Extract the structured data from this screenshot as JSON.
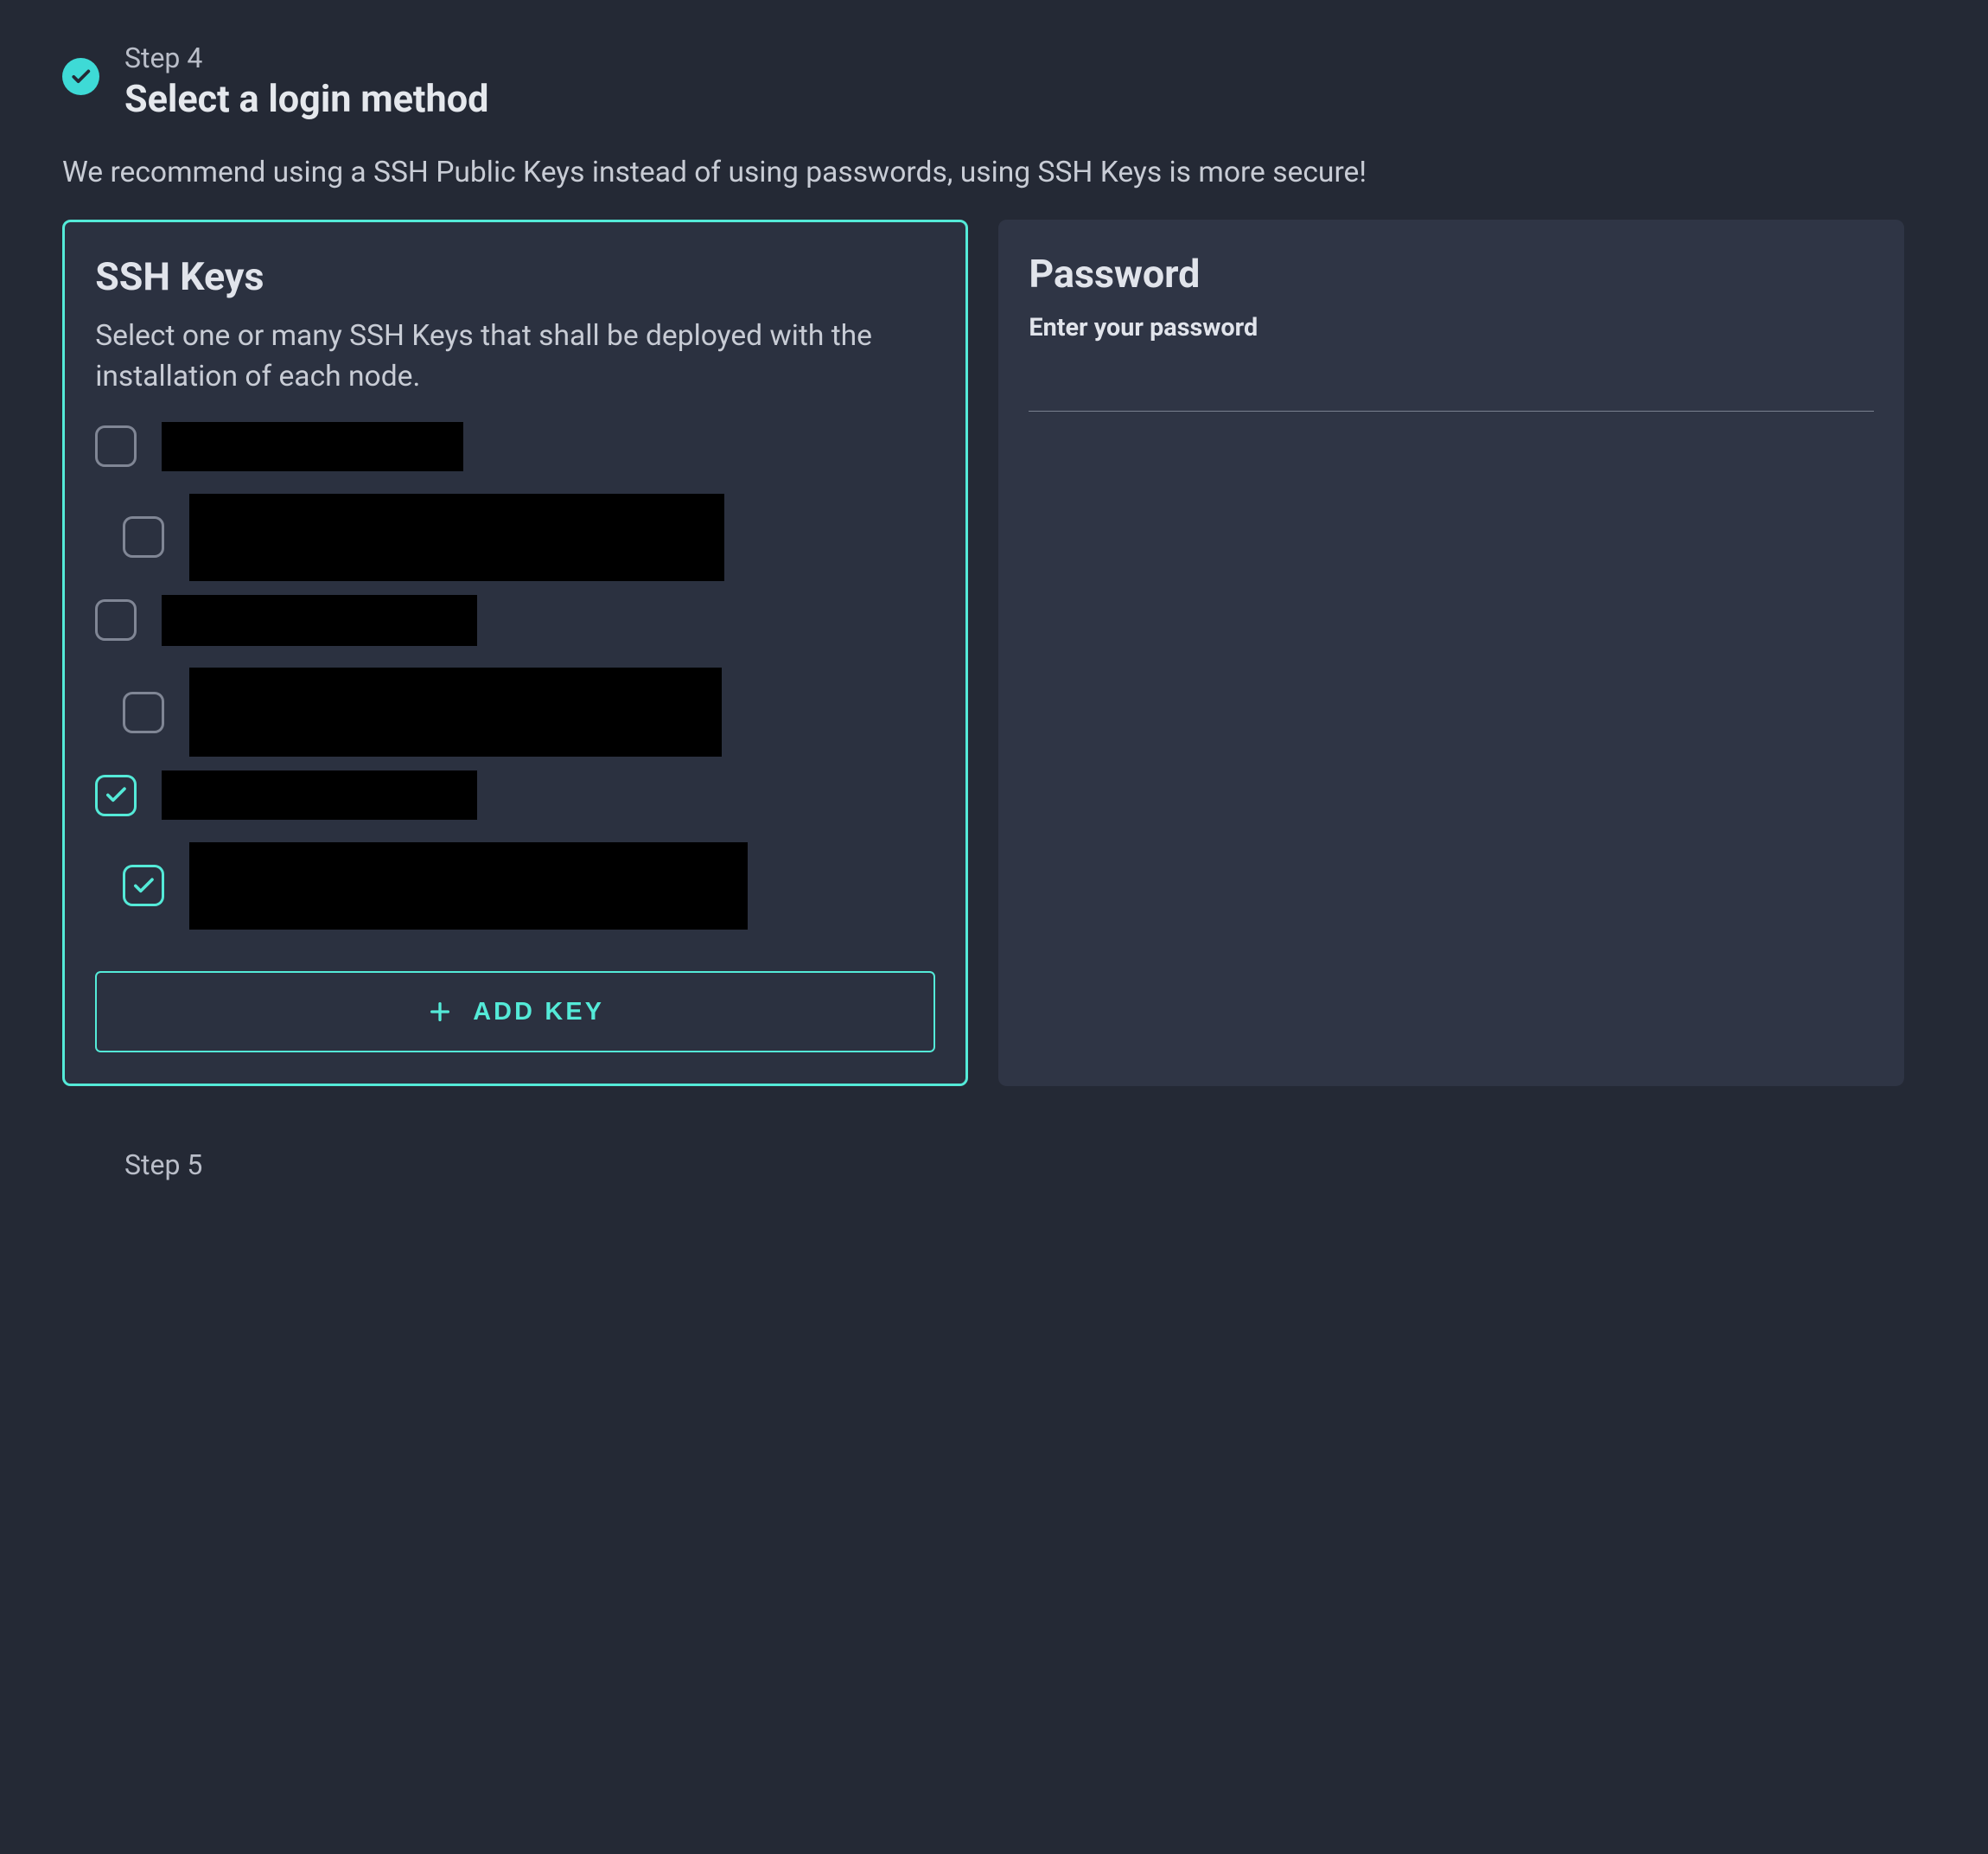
{
  "step": {
    "label": "Step 4",
    "title": "Select a login method"
  },
  "description": "We recommend using a SSH Public Keys instead of using passwords, using SSH Keys is more secure!",
  "ssh_panel": {
    "title": "SSH Keys",
    "description": "Select one or many SSH Keys that shall be deployed with the installation of each node.",
    "keys": [
      {
        "checked": false
      },
      {
        "checked": false,
        "sub": true
      },
      {
        "checked": false
      },
      {
        "checked": false,
        "sub": true
      },
      {
        "checked": true
      },
      {
        "checked": true,
        "sub": true
      }
    ],
    "add_key_label": "ADD KEY"
  },
  "password_panel": {
    "title": "Password",
    "label": "Enter your password",
    "value": ""
  },
  "next_step_label": "Step 5",
  "colors": {
    "accent": "#54ead8",
    "bg": "#242935",
    "panel": "#2f3545"
  }
}
